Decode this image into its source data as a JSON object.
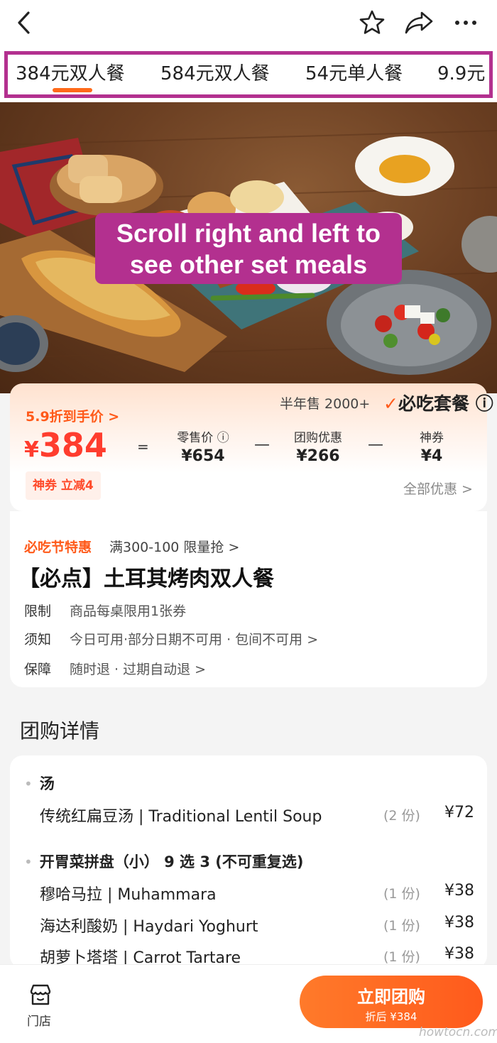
{
  "topbar": {
    "icons": [
      "back-icon",
      "star-icon",
      "share-icon",
      "more-icon"
    ]
  },
  "tabs": [
    {
      "label": "384元双人餐",
      "selected": true
    },
    {
      "label": "584元双人餐",
      "selected": false
    },
    {
      "label": "54元单人餐",
      "selected": false
    },
    {
      "label": "9.9元",
      "selected": false
    }
  ],
  "annotation": {
    "line1": "Scroll right and left to",
    "line2": "see other set meals",
    "color": "#b3308f"
  },
  "price": {
    "discount_label": "5.9折到手价 >",
    "currency": "¥",
    "amount": "384",
    "equals": "=",
    "retail_label": "零售价 ⓘ",
    "retail_value": "¥654",
    "minus": "—",
    "group_label": "团购优惠",
    "group_value": "¥266",
    "coupon_label": "神券",
    "coupon_value": "¥4",
    "sales": "半年售 2000+",
    "must_eat_badge": "必吃套餐",
    "must_eat_info": "ⓘ",
    "coupon_pill": "神券 立减4",
    "all_offers": "全部优惠 >"
  },
  "deal": {
    "festival_tag": "必吃节特惠",
    "festival_desc": "满300-100 限量抢 >",
    "title": "【必点】土耳其烤肉双人餐",
    "rows": [
      {
        "key": "限制",
        "value": "商品每桌限用1张券"
      },
      {
        "key": "须知",
        "value": "今日可用·部分日期不可用 · 包间不可用 >"
      },
      {
        "key": "保障",
        "value": "随时退 · 过期自动退 >"
      }
    ]
  },
  "details": {
    "heading": "团购详情",
    "cat1": "汤",
    "cat2": "开胃菜拼盘（小） 9 选 3 (不可重复选)",
    "items": [
      {
        "name": "传统红扁豆汤 | Traditional Lentil Soup",
        "qty": "(2 份)",
        "price": "¥72"
      },
      {
        "name": "穆哈马拉 | Muhammara",
        "qty": "(1 份)",
        "price": "¥38"
      },
      {
        "name": "海达利酸奶 | Haydari Yoghurt",
        "qty": "(1 份)",
        "price": "¥38"
      },
      {
        "name": "胡萝卜塔塔 | Carrot Tartare",
        "qty": "(1 份)",
        "price": "¥38"
      }
    ]
  },
  "bottom": {
    "store_label": "门店",
    "buy_label": "立即团购",
    "buy_sub": "折后 ¥384",
    "accent": "#ff5a1c"
  },
  "watermark": "howtocn.com"
}
